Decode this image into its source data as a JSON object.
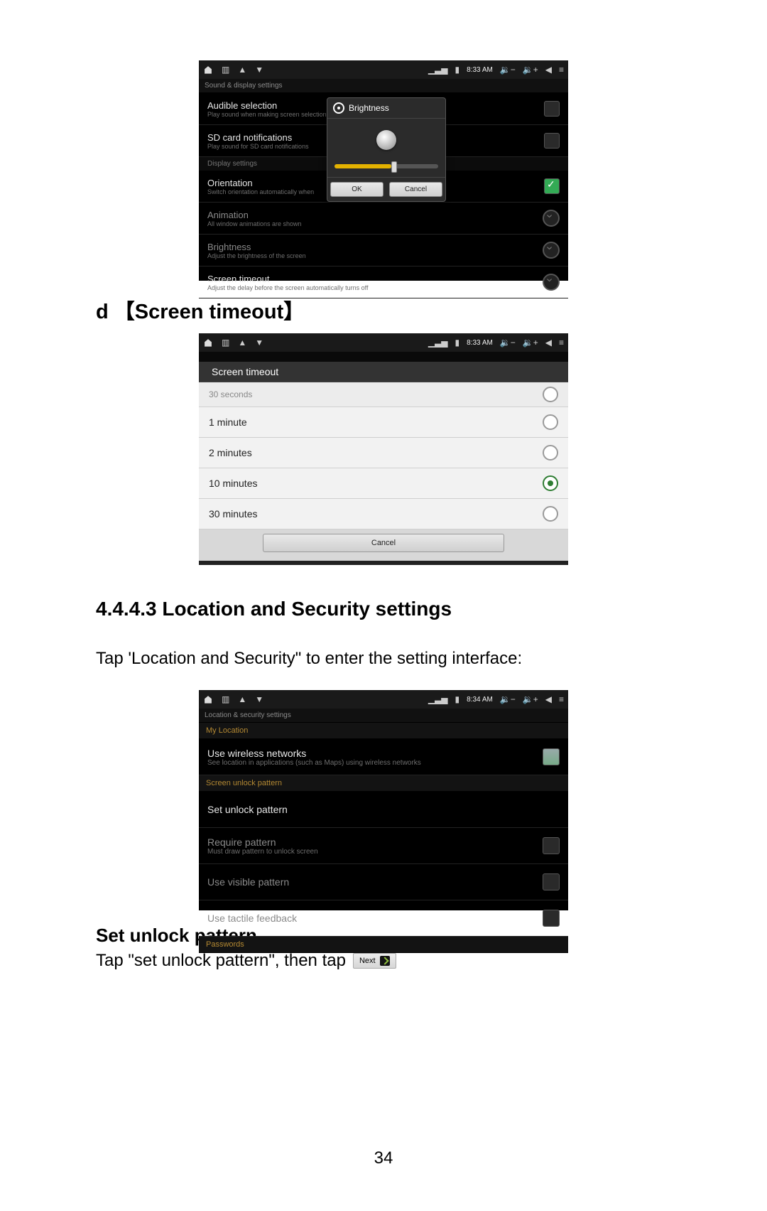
{
  "statusbar": {
    "time": "8:33 AM",
    "time2": "8:33 AM",
    "time3": "8:34 AM"
  },
  "shot1": {
    "crumb": "Sound & display settings",
    "rows": {
      "audible": {
        "title": "Audible selection",
        "sub": "Play sound when making screen selection"
      },
      "sdnotif": {
        "title": "SD card notifications",
        "sub": "Play sound for SD card notifications"
      },
      "dispHeader": "Display settings",
      "orient": {
        "title": "Orientation",
        "sub": "Switch orientation automatically when"
      },
      "anim": {
        "title": "Animation",
        "sub": "All window animations are shown"
      },
      "bright": {
        "title": "Brightness",
        "sub": "Adjust the brightness of the screen"
      },
      "timeout": {
        "title": "Screen timeout",
        "sub": "Adjust the delay before the screen automatically turns off"
      }
    },
    "dialog": {
      "title": "Brightness",
      "ok": "OK",
      "cancel": "Cancel"
    }
  },
  "heading_d": "d  【Screen timeout】",
  "shot2": {
    "sheetTitle": "Screen timeout",
    "opts": {
      "o30s": "30 seconds",
      "o1m": "1 minute",
      "o2m": "2 minutes",
      "o10m": "10 minutes",
      "o30m": "30 minutes"
    },
    "cancel": "Cancel"
  },
  "heading_443": "4.4.4.3 Location and Security settings",
  "body1": "Tap 'Location and Security\" to enter the setting interface:",
  "shot3": {
    "crumb": "Location & security settings",
    "catLoc": "My Location",
    "wireless": {
      "title": "Use wireless networks",
      "sub": "See location in applications (such as Maps) using wireless networks"
    },
    "catPat": "Screen unlock pattern",
    "setpat": "Set unlock pattern",
    "reqpat": {
      "title": "Require pattern",
      "sub": "Must draw pattern to unlock screen"
    },
    "visible": "Use visible pattern",
    "tactile": "Use tactile feedback",
    "catPwd": "Passwords"
  },
  "sub_unlock": "Set unlock pattern",
  "body2": "Tap \"set unlock pattern\", then tap",
  "nextLabel": "Next",
  "pageNum": "34"
}
